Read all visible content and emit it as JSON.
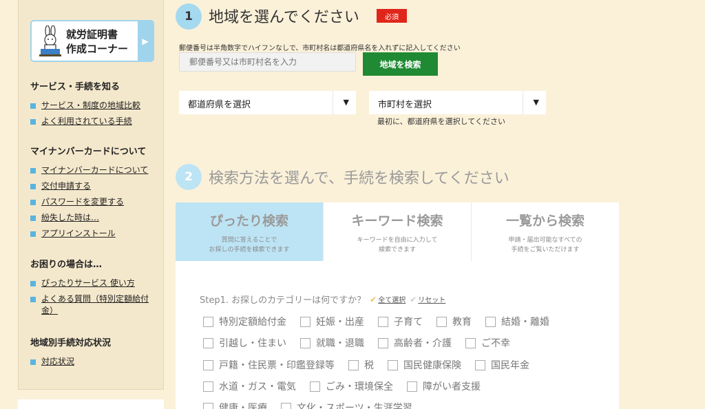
{
  "sidebar": {
    "banner": {
      "line1": "就労証明書",
      "line2": "作成コーナー",
      "arrow": "▶"
    },
    "sections": [
      {
        "heading": "サービス・手続を知る",
        "links": [
          "サービス・制度の地域比較",
          "よく利用されている手続"
        ]
      },
      {
        "heading": "マイナンバーカードについて",
        "links": [
          "マイナンバーカードについて",
          "交付申請する",
          "パスワードを変更する",
          "紛失した時は…",
          "アプリインストール"
        ]
      },
      {
        "heading": "お困りの場合は…",
        "links": [
          "ぴったりサービス 使い方",
          "よくある質問（特別定額給付金）"
        ]
      },
      {
        "heading": "地域別手続対応状況",
        "links": [
          "対応状況"
        ]
      }
    ]
  },
  "step1": {
    "number": "1",
    "title": "地域を選んでください",
    "required": "必須",
    "note": "郵便番号は半角数字でハイフンなしで、市町村名は都道府県名を入れずに記入してください",
    "postal_placeholder": "郵便番号又は市町村名を入力",
    "search_button": "地域を検索",
    "prefecture_select": "都道府県を選択",
    "city_select": "市町村を選択",
    "select_arrow": "▼",
    "city_hint": "最初に、都道府県を選択してください"
  },
  "step2": {
    "number": "2",
    "title": "検索方法を選んで、手続を検索してください",
    "tabs": [
      {
        "title": "ぴったり検索",
        "desc1": "質問に答えることで",
        "desc2": "お探しの手続を検索できます"
      },
      {
        "title": "キーワード検索",
        "desc1": "キーワードを自由に入力して",
        "desc2": "検索できます"
      },
      {
        "title": "一覧から検索",
        "desc1": "申請・届出可能なすべての",
        "desc2": "手続をご覧いただけます"
      }
    ],
    "step1_label": "Step1. お探しのカテゴリーは何ですか？",
    "select_all": "全て選択",
    "reset": "リセット",
    "categories": [
      [
        "特別定額給付金",
        "妊娠・出産",
        "子育て",
        "教育",
        "結婚・離婚"
      ],
      [
        "引越し・住まい",
        "就職・退職",
        "高齢者・介護",
        "ご不幸"
      ],
      [
        "戸籍・住民票・印鑑登録等",
        "税",
        "国民健康保険",
        "国民年金"
      ],
      [
        "水道・ガス・電気",
        "ごみ・環境保全",
        "障がい者支援"
      ],
      [
        "健康・医療",
        "文化・スポーツ・生涯学習"
      ]
    ]
  }
}
